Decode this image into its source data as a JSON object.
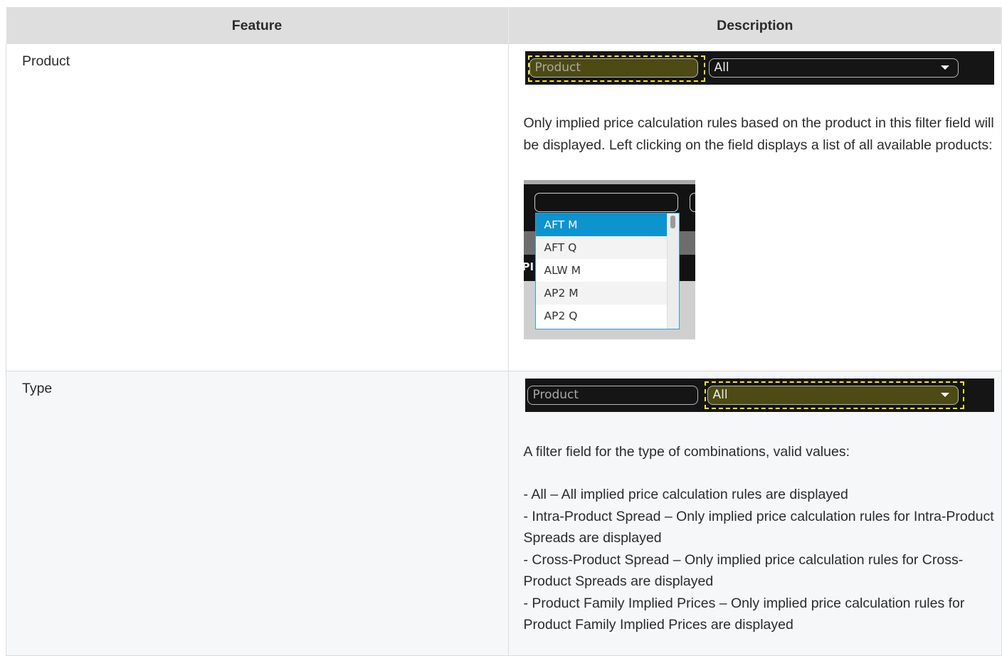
{
  "table": {
    "headers": [
      "Feature",
      "Description"
    ],
    "rows": [
      {
        "feature": "Product",
        "bar": {
          "field1": "Product",
          "field2": "All",
          "highlighted": "field1"
        },
        "text": "Only implied price calculation rules based on the product in this filter field will be displayed. Left clicking on the field displays a list of all available products:",
        "dropdown": {
          "items": [
            "AFT M",
            "AFT Q",
            "ALW M",
            "AP2 M",
            "AP2 Q"
          ],
          "selected": "AFT M",
          "fragment": "PI"
        }
      },
      {
        "feature": "Type",
        "bar": {
          "field1": "Product",
          "field2": "All",
          "highlighted": "field2"
        },
        "intro": "A filter field for the type of combinations, valid values:",
        "values": [
          "- All – All implied price calculation rules are displayed",
          "- Intra-Product Spread – Only implied price calculation rules for Intra-Product Spreads are displayed",
          "- Cross-Product Spread – Only implied price calculation rules for Cross-Product Spreads are displayed",
          "- Product Family Implied Prices – Only implied price calculation rules for Product Family Implied Prices are displayed"
        ]
      }
    ]
  },
  "colors": {
    "header_bg": "#dedede",
    "highlight_dash": "#ffee00",
    "highlight_fill": "#4d4a14",
    "selection_blue": "#0c94cf"
  }
}
